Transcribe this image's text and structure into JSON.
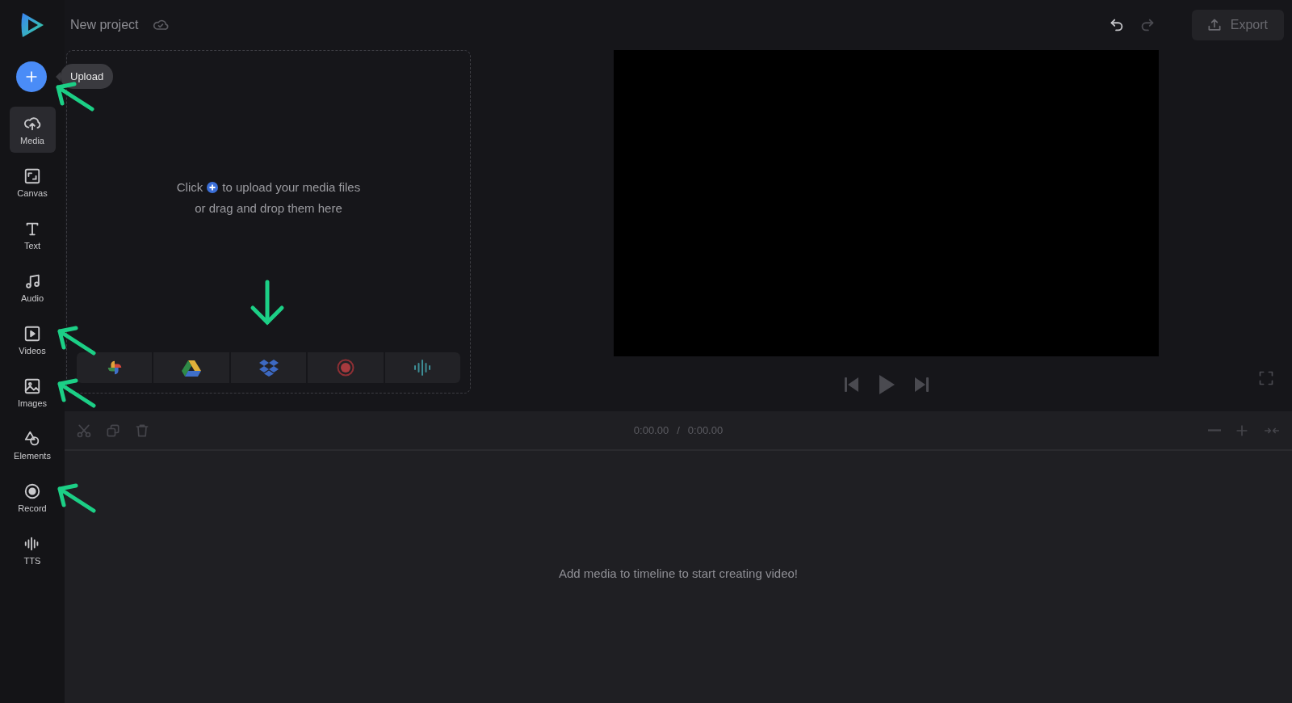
{
  "header": {
    "project_name": "New project",
    "undo_disabled": false,
    "redo_disabled": true,
    "export_label": "Export",
    "export_disabled": true
  },
  "upload": {
    "tooltip": "Upload",
    "annotated": true
  },
  "sidebar": {
    "items": [
      {
        "kind": "media",
        "label": "Media",
        "selected": true,
        "annotated": false
      },
      {
        "kind": "canvas",
        "label": "Canvas",
        "selected": false,
        "annotated": false
      },
      {
        "kind": "text",
        "label": "Text",
        "selected": false,
        "annotated": false
      },
      {
        "kind": "audio",
        "label": "Audio",
        "selected": false,
        "annotated": false
      },
      {
        "kind": "videos",
        "label": "Videos",
        "selected": false,
        "annotated": true
      },
      {
        "kind": "images",
        "label": "Images",
        "selected": false,
        "annotated": true
      },
      {
        "kind": "elements",
        "label": "Elements",
        "selected": false,
        "annotated": false
      },
      {
        "kind": "record",
        "label": "Record",
        "selected": false,
        "annotated": true
      },
      {
        "kind": "tts",
        "label": "TTS",
        "selected": false,
        "annotated": false
      }
    ]
  },
  "media_panel": {
    "hint_start": "Click",
    "hint_end": "to upload your media files",
    "hint_line2": "or drag and drop them here",
    "sources_annotated": true,
    "sources": [
      {
        "kind": "photos"
      },
      {
        "kind": "drive"
      },
      {
        "kind": "dropbox"
      },
      {
        "kind": "record"
      },
      {
        "kind": "audio"
      }
    ]
  },
  "timeline": {
    "current_time": "0:00.00",
    "separator": "/",
    "total_time": "0:00.00",
    "empty_message": "Add media to timeline to start creating video!"
  }
}
